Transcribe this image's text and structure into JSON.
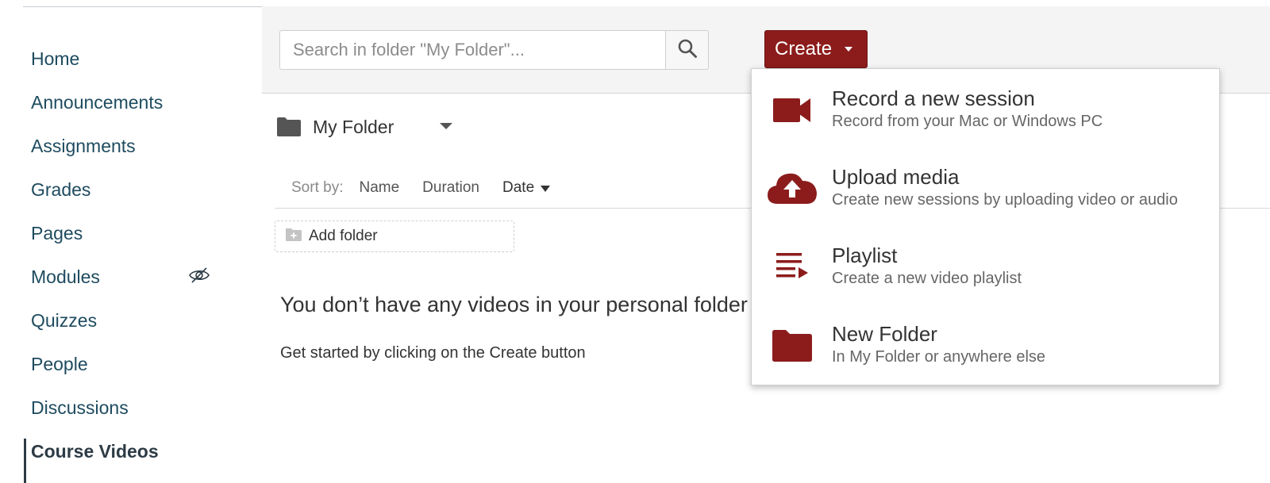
{
  "course_nav": {
    "items": [
      {
        "label": "Home"
      },
      {
        "label": "Announcements"
      },
      {
        "label": "Assignments"
      },
      {
        "label": "Grades"
      },
      {
        "label": "Pages"
      },
      {
        "label": "Modules",
        "hidden_from_students": true
      },
      {
        "label": "Quizzes"
      },
      {
        "label": "People"
      },
      {
        "label": "Discussions"
      },
      {
        "label": "Course Videos",
        "active": true
      }
    ],
    "hidden_icon": "eye-slash-icon"
  },
  "toolbar": {
    "search_placeholder": "Search in folder \"My Folder\"...",
    "search_icon": "search-icon",
    "create_label": "Create"
  },
  "folder": {
    "name": "My Folder",
    "icon": "folder-icon"
  },
  "sort": {
    "label": "Sort by:",
    "options": [
      "Name",
      "Duration",
      "Date"
    ],
    "active": "Date"
  },
  "add_folder_label": "Add folder",
  "empty_state": {
    "title": "You don’t have any videos in your personal folder",
    "subtitle": "Get started by clicking on the Create button"
  },
  "create_menu": {
    "items": [
      {
        "title": "Record a new session",
        "subtitle": "Record from your Mac or Windows PC",
        "icon": "video-camera-icon"
      },
      {
        "title": "Upload media",
        "subtitle": "Create new sessions by uploading video or audio",
        "icon": "cloud-upload-icon"
      },
      {
        "title": "Playlist",
        "subtitle": "Create a new video playlist",
        "icon": "playlist-icon"
      },
      {
        "title": "New Folder",
        "subtitle": "In My Folder or anywhere else",
        "icon": "folder-icon"
      }
    ]
  },
  "colors": {
    "accent": "#8c1c1c",
    "nav_link": "#1e4b5f",
    "toolbar_bg": "#f4f4f4"
  }
}
